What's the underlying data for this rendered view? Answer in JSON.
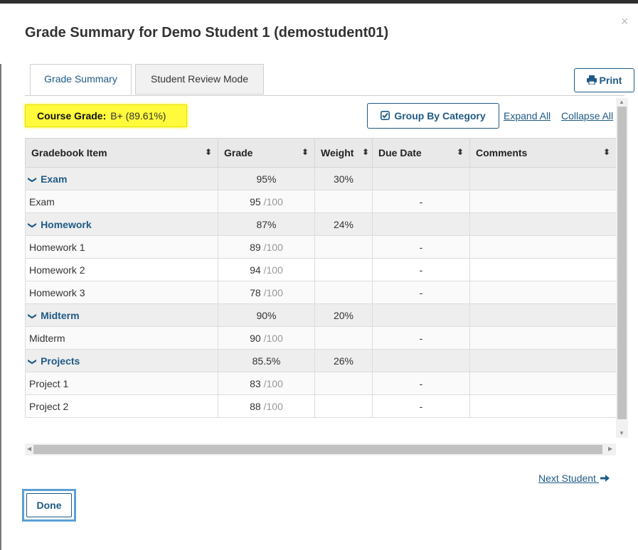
{
  "modal": {
    "title": "Grade Summary for Demo Student 1 (demostudent01)",
    "close_icon": "×"
  },
  "tabs": [
    {
      "label": "Grade Summary",
      "active": true
    },
    {
      "label": "Student Review Mode",
      "active": false
    }
  ],
  "toolbar": {
    "print_label": "Print",
    "print_icon": "printer-icon",
    "course_grade_label": "Course Grade:",
    "course_grade_value": "B+ (89.61%)",
    "group_by_label": "Group By Category",
    "group_by_icon": "checkbox-checked-icon",
    "expand_all": "Expand All",
    "collapse_all": "Collapse All"
  },
  "table": {
    "headers": [
      "Gradebook Item",
      "Grade",
      "Weight",
      "Due Date",
      "Comments"
    ],
    "rows": [
      {
        "type": "category",
        "name": "Exam",
        "grade": "95%",
        "weight": "30%"
      },
      {
        "type": "item",
        "name": "Exam",
        "points": "95",
        "out_of": "/100",
        "due": "-"
      },
      {
        "type": "category",
        "name": "Homework",
        "grade": "87%",
        "weight": "24%"
      },
      {
        "type": "item",
        "name": "Homework 1",
        "points": "89",
        "out_of": "/100",
        "due": "-"
      },
      {
        "type": "item",
        "name": "Homework 2",
        "points": "94",
        "out_of": "/100",
        "due": "-"
      },
      {
        "type": "item",
        "name": "Homework 3",
        "points": "78",
        "out_of": "/100",
        "due": "-"
      },
      {
        "type": "category",
        "name": "Midterm",
        "grade": "90%",
        "weight": "20%"
      },
      {
        "type": "item",
        "name": "Midterm",
        "points": "90",
        "out_of": "/100",
        "due": "-"
      },
      {
        "type": "category",
        "name": "Projects",
        "grade": "85.5%",
        "weight": "26%"
      },
      {
        "type": "item",
        "name": "Project 1",
        "points": "83",
        "out_of": "/100",
        "due": "-"
      },
      {
        "type": "item",
        "name": "Project 2",
        "points": "88",
        "out_of": "/100",
        "due": "-"
      }
    ]
  },
  "footer": {
    "next_student": "Next Student",
    "done_label": "Done"
  },
  "colors": {
    "accent": "#1f5a86",
    "highlight": "#fffa3b"
  }
}
